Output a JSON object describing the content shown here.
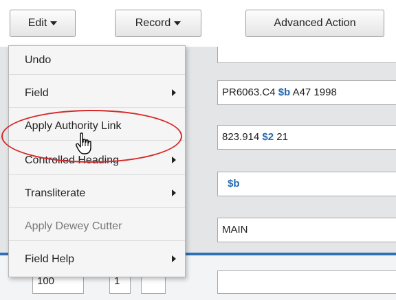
{
  "toolbar": {
    "edit_label": "Edit",
    "record_label": "Record",
    "advanced_label": "Advanced Action"
  },
  "menu": {
    "items": [
      {
        "label": "Undo",
        "submenu": false,
        "enabled": true
      },
      {
        "label": "Field",
        "submenu": true,
        "enabled": true
      },
      {
        "label": "Apply Authority Link",
        "submenu": false,
        "enabled": true
      },
      {
        "label": "Controlled Heading",
        "submenu": true,
        "enabled": true
      },
      {
        "label": "Transliterate",
        "submenu": true,
        "enabled": true
      },
      {
        "label": "Apply Dewey Cutter",
        "submenu": false,
        "enabled": false
      },
      {
        "label": "Field Help",
        "submenu": true,
        "enabled": true
      }
    ]
  },
  "fields": {
    "call_number": {
      "text1": "PR6063.C4 ",
      "sub": "$b",
      "text2": " A47 1998"
    },
    "dewey": {
      "text1": "823.914 ",
      "sub": "$2",
      "text2": " 21"
    },
    "subfield_b": {
      "sub": "$b"
    },
    "location": {
      "text": "MAIN"
    }
  },
  "lower": {
    "tag": "100",
    "ind1": "1",
    "ind2": ""
  },
  "colors": {
    "highlight": "#d62828",
    "subfield": "#2469b3",
    "separator": "#2f6fb5"
  }
}
